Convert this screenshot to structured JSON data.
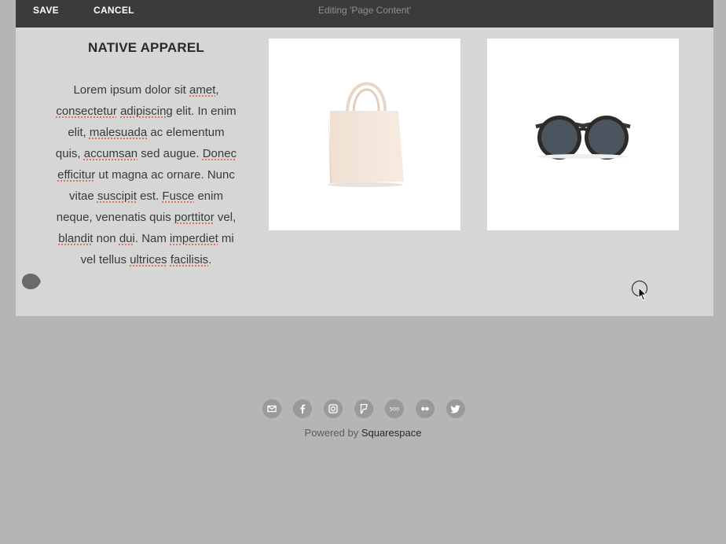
{
  "toolbar": {
    "save_label": "SAVE",
    "cancel_label": "CANCEL",
    "editing_title": "Editing 'Page Content'"
  },
  "content": {
    "heading": "NATIVE APPAREL",
    "paragraph_parts": [
      "Lorem ipsum dolor sit ",
      "amet",
      ",",
      "\n",
      "consectetur",
      " ",
      "adipiscing",
      " elit. In enim",
      "\n",
      "elit, ",
      "malesuada",
      " ac elementum",
      "\n",
      "quis, ",
      "accumsan",
      " sed augue. ",
      "Donec",
      "\n",
      "efficitur",
      " ut magna ac ornare. Nunc",
      "\n",
      "vitae ",
      "suscipit",
      " est. ",
      "Fusce",
      " enim",
      "\n",
      "neque, venenatis quis ",
      "porttitor",
      " vel,",
      "\n",
      "blandit",
      " non ",
      "dui",
      ". Nam ",
      "imperdiet",
      " mi",
      "\n",
      "vel tellus ",
      "ultrices",
      " ",
      "facilisis",
      "."
    ],
    "misspelled": [
      "amet",
      "consectetur",
      "adipiscing",
      "malesuada",
      "accumsan",
      "Donec",
      "efficitur",
      "suscipit",
      "Fusce",
      "porttitor",
      "blandit",
      "dui",
      "imperdiet",
      "ultrices",
      "facilisis"
    ],
    "images": [
      {
        "icon": "tote-bag-image"
      },
      {
        "icon": "sunglasses-image"
      }
    ]
  },
  "footer": {
    "social_icons": [
      "email-icon",
      "facebook-icon",
      "instagram-icon",
      "foursquare-icon",
      "500px-icon",
      "flickr-icon",
      "twitter-icon"
    ],
    "powered_by": "Powered by ",
    "brand": "Squarespace"
  },
  "colors": {
    "toolbar_bg": "#3b3b3b",
    "content_bg": "#d6d6d6",
    "page_bg": "#b5b5b5",
    "spell_underline": "#e0503a"
  }
}
